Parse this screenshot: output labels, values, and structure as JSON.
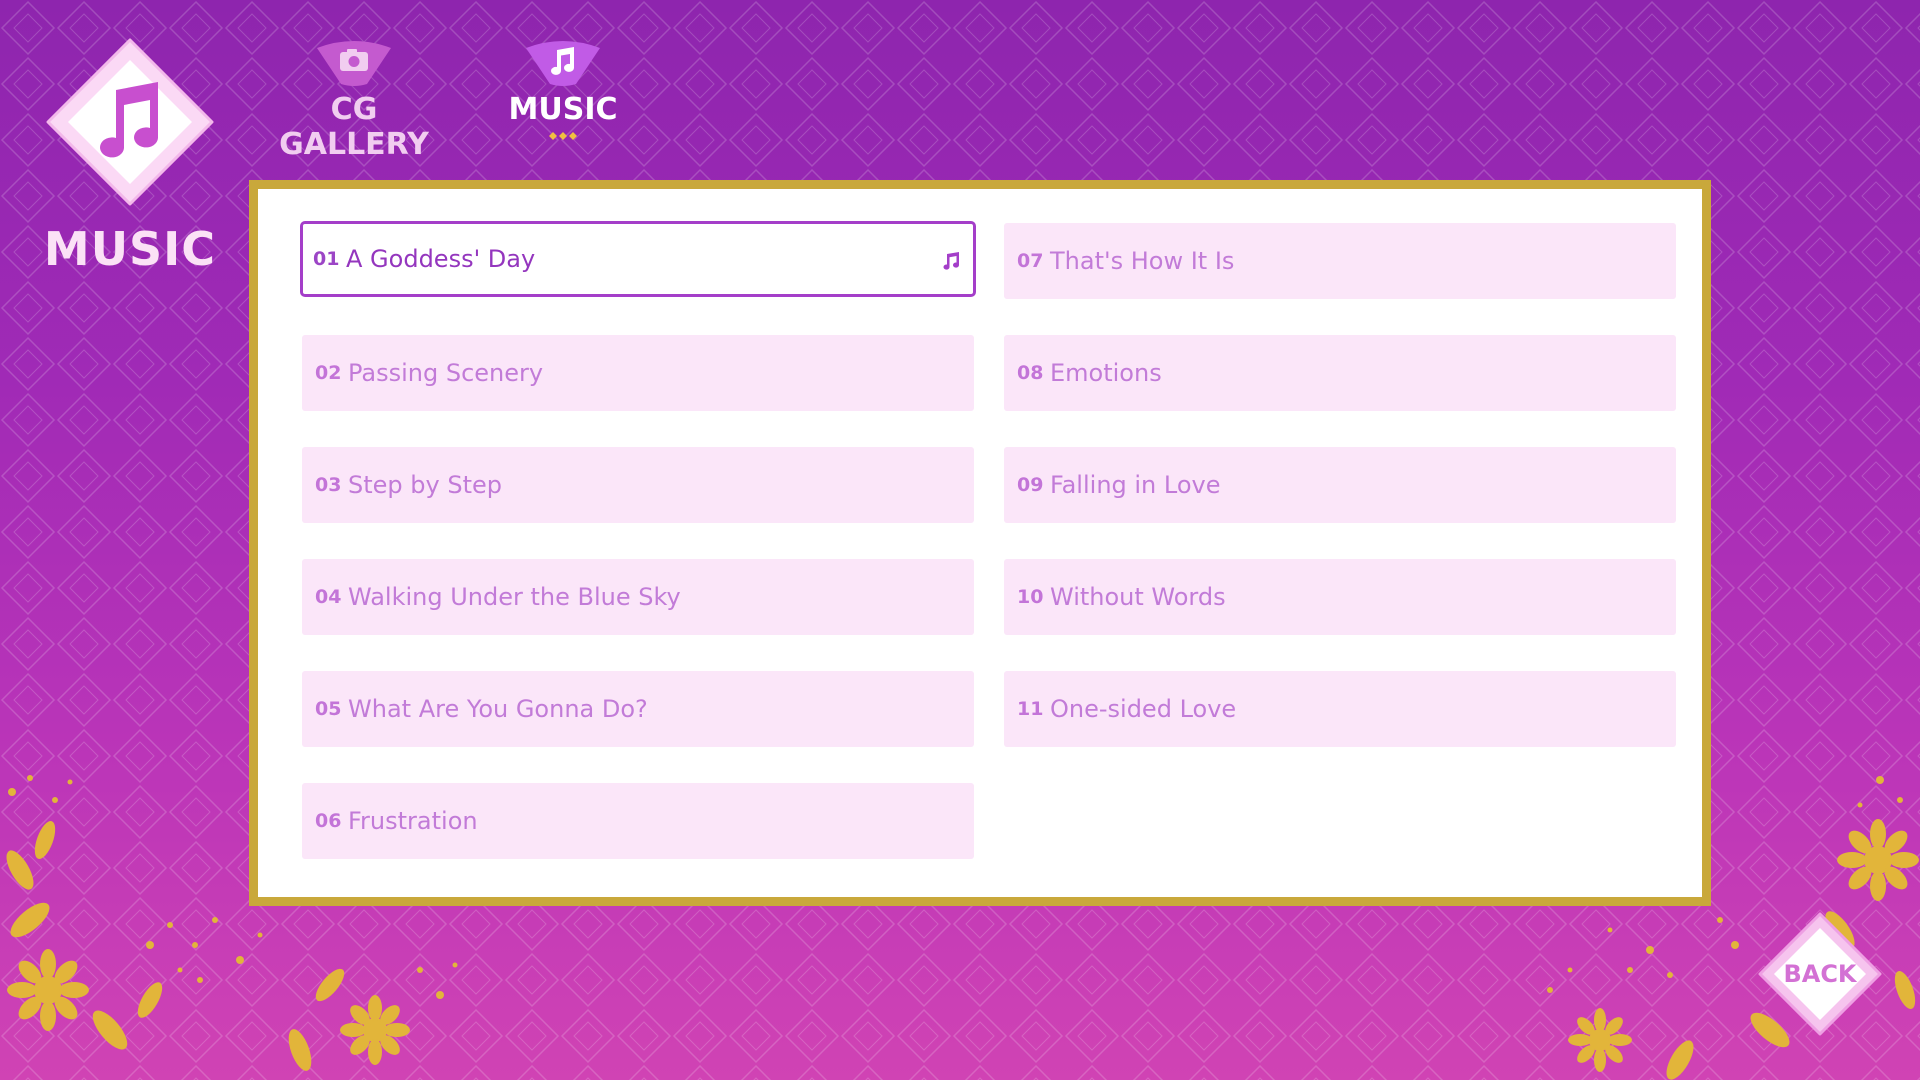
{
  "page": {
    "title": "MUSIC",
    "badge_icon": "music-note-icon"
  },
  "tabs": [
    {
      "label": "CG GALLERY",
      "icon": "camera-icon",
      "active": false
    },
    {
      "label": "MUSIC",
      "icon": "music-note-icon",
      "active": true
    }
  ],
  "tracks_left": [
    {
      "num": "01",
      "title": "A Goddess' Day",
      "selected": true
    },
    {
      "num": "02",
      "title": "Passing Scenery"
    },
    {
      "num": "03",
      "title": "Step by Step"
    },
    {
      "num": "04",
      "title": "Walking Under the Blue Sky"
    },
    {
      "num": "05",
      "title": "What Are You Gonna Do?"
    },
    {
      "num": "06",
      "title": "Frustration"
    }
  ],
  "tracks_right": [
    {
      "num": "07",
      "title": "That's How It Is"
    },
    {
      "num": "08",
      "title": "Emotions"
    },
    {
      "num": "09",
      "title": "Falling in Love"
    },
    {
      "num": "10",
      "title": "Without Words"
    },
    {
      "num": "11",
      "title": "One-sided Love"
    }
  ],
  "back": {
    "label": "BACK"
  },
  "colors": {
    "background_top": "#8e25ae",
    "background_bottom": "#d043b4",
    "panel_border": "#c9a83b",
    "row_fill": "#fbe6f9",
    "selected_border": "#a43ec9",
    "text_accent": "#c27bd8",
    "flower_gold": "#e2b53a"
  }
}
